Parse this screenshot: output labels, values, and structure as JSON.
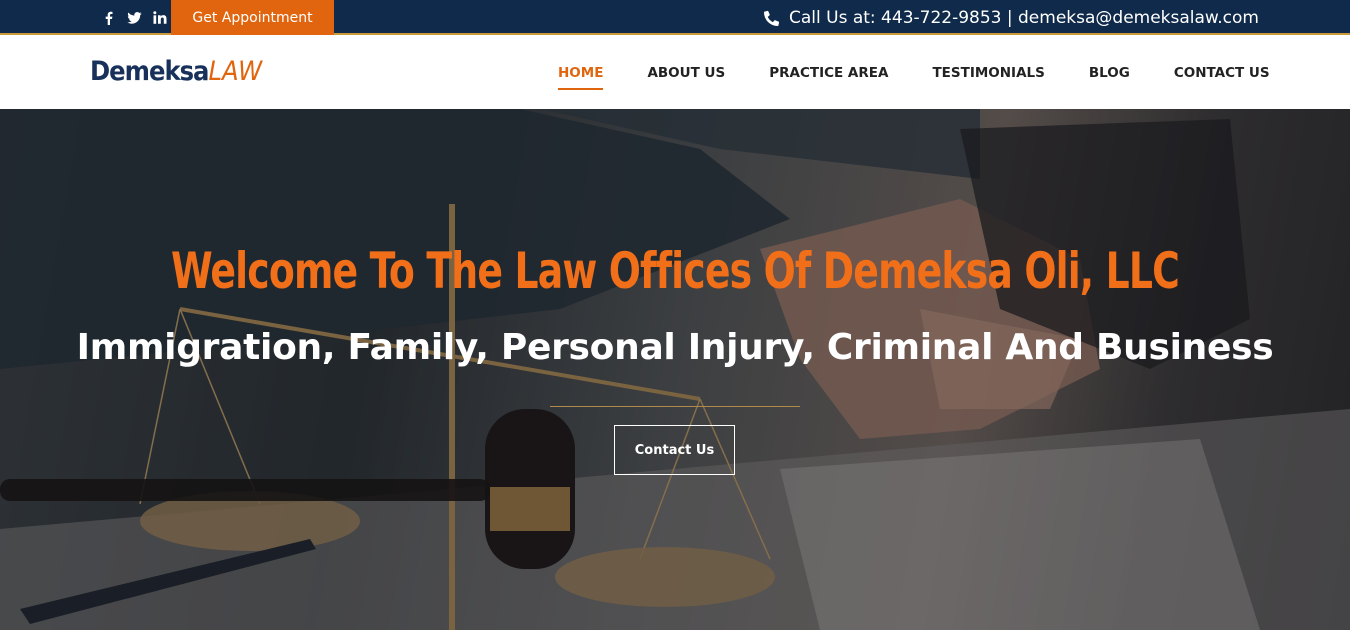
{
  "topbar": {
    "social": [
      {
        "name": "facebook-icon",
        "glyph": "f"
      },
      {
        "name": "twitter-icon",
        "glyph": "t"
      },
      {
        "name": "linkedin-icon",
        "glyph": "in"
      }
    ],
    "appointment_label": "Get Appointment",
    "contact_text": "Call Us at: 443-722-9853 | demeksa@demeksalaw.com"
  },
  "nav": {
    "logo_part1": "Demeksa",
    "logo_part2": "LAW",
    "items": [
      {
        "label": "HOME",
        "active": true
      },
      {
        "label": "ABOUT US",
        "active": false
      },
      {
        "label": "PRACTICE AREA",
        "active": false
      },
      {
        "label": "TESTIMONIALS",
        "active": false
      },
      {
        "label": "BLOG",
        "active": false
      },
      {
        "label": "CONTACT US",
        "active": false
      }
    ]
  },
  "hero": {
    "headline": "Welcome To The Law Offices Of Demeksa Oli, LLC",
    "subheadline": "Immigration, Family, Personal Injury, Criminal And Business",
    "cta_label": "Contact Us"
  },
  "colors": {
    "topbar_bg": "#0f2a4a",
    "accent_orange": "#e0650e",
    "logo_navy": "#17315a",
    "headline_orange": "#f26f1a"
  }
}
